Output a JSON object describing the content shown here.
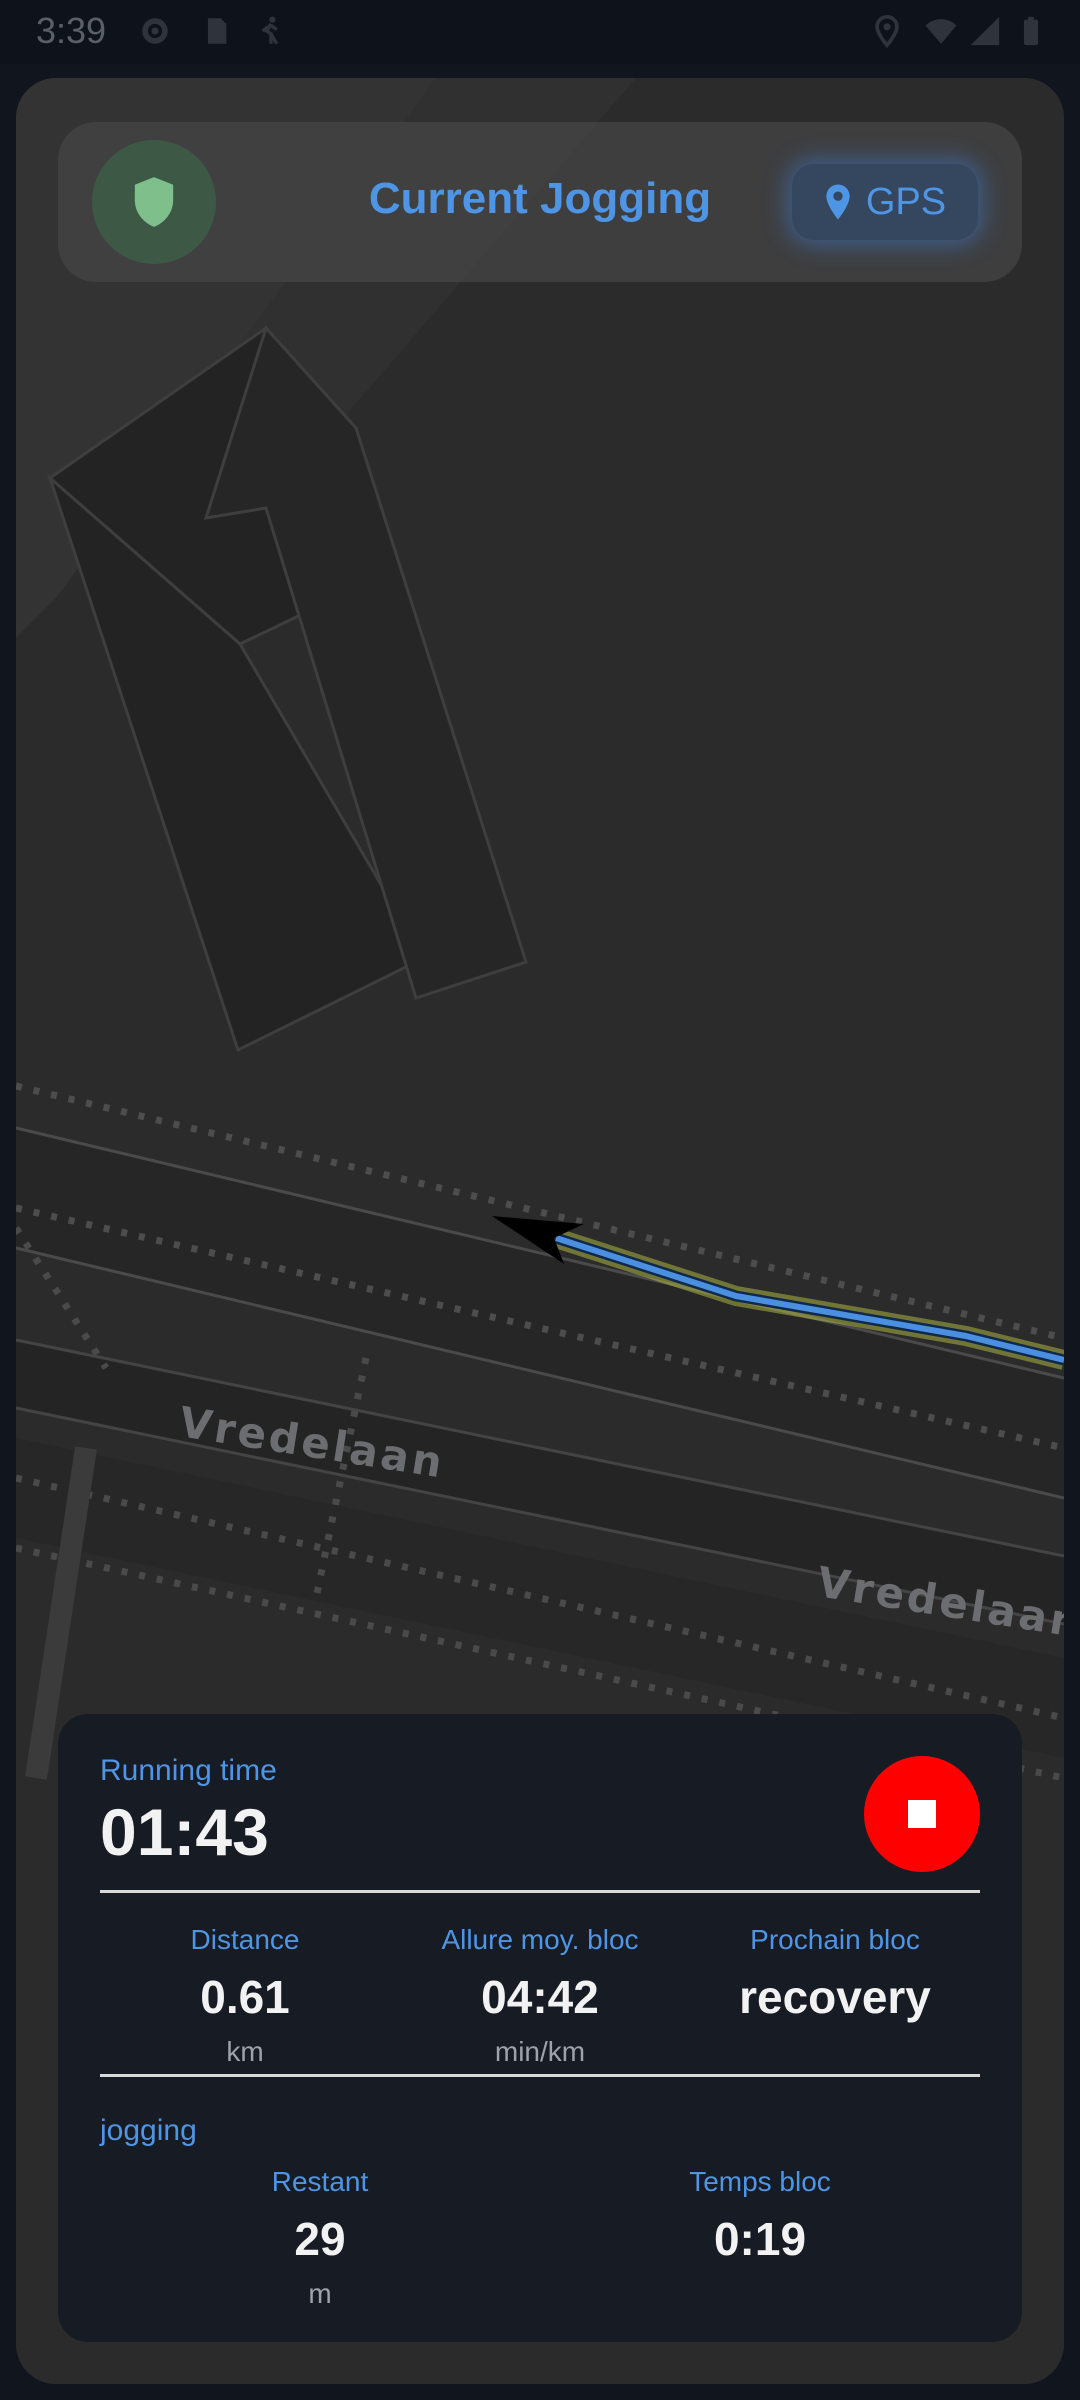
{
  "status_bar": {
    "time": "3:39",
    "icons": [
      "settings-icon",
      "sd-card-icon",
      "walk-icon",
      "location-icon",
      "wifi-icon",
      "signal-icon",
      "battery-icon"
    ]
  },
  "header": {
    "title": "Current Jogging",
    "gps_label": "GPS",
    "shield_color": "#7fbf8c",
    "accent_color": "#4f95e6"
  },
  "map": {
    "street_labels": [
      "Vredelaan",
      "Vredelaan"
    ],
    "route_color": "#4a8fe0",
    "route_glow": "#c8d042"
  },
  "stats": {
    "running_time_label": "Running time",
    "running_time": "01:43",
    "stop_button_color": "#ff0000",
    "columns": [
      {
        "label": "Distance",
        "value": "0.61",
        "unit": "km"
      },
      {
        "label": "Allure moy. bloc",
        "value": "04:42",
        "unit": "min/km"
      },
      {
        "label": "Prochain bloc",
        "value": "recovery",
        "unit": ""
      }
    ],
    "block_name": "jogging",
    "block_stats": [
      {
        "label": "Restant",
        "value": "29",
        "unit": "m"
      },
      {
        "label": "Temps bloc",
        "value": "0:19",
        "unit": ""
      }
    ]
  }
}
